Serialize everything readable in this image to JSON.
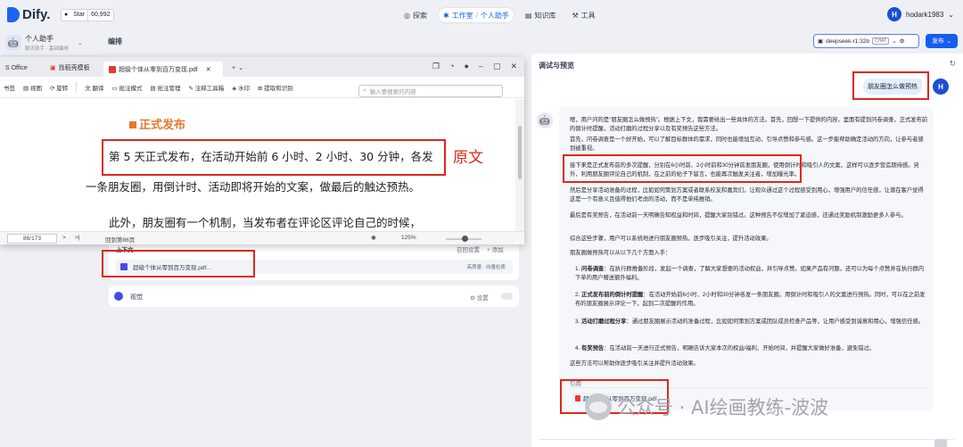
{
  "brand": {
    "name": "Dify.",
    "github_label": "Star",
    "github_count": "60,992"
  },
  "nav": {
    "explore": "探索",
    "studio": "工作室",
    "separator": "/",
    "app": "个人助手",
    "knowledge": "知识库",
    "tools": "工具"
  },
  "user": {
    "initial": "H",
    "name": "hodark1983"
  },
  "app": {
    "name": "个人助手",
    "type": "聊天助手 · 基础编排"
  },
  "editor": {
    "title": "编排"
  },
  "model": {
    "name": "deepseek-r1:32b",
    "mode": "CHAT",
    "publish": "发布"
  },
  "pdf": {
    "tabs": [
      "S Office",
      "找稻壳模板",
      "超级个体从零到百万变现.pdf"
    ],
    "new_tab": "+",
    "toolbar": [
      "书签",
      "视图",
      "旋转",
      "翻译",
      "批注模式",
      "批注管理",
      "注释工具箱",
      "水印",
      "提取和识别"
    ],
    "search_placeholder": "输入要搜索的内容",
    "section_heading": "正式发布",
    "lines": [
      "第 5 天正式发布，在活动开始前 6 小时、2 小时、30 分钟，各发",
      "一条朋友圈，用倒计时、活动即将开始的文案，做最后的触达预热。",
      "此外，朋友圈有一个机制，当发布者在评论区评论自己的时候，"
    ],
    "page_indicator": "86/173",
    "status_back": "回到第86页",
    "zoom": "125%",
    "annotation": "原文"
  },
  "context": {
    "header": "上下文",
    "recall_settings": "召回设置",
    "add": "+ 添加",
    "file_name": "超级个体从零到百万变现.pdf...",
    "file_tags": "高质量 · 向量检索"
  },
  "vision": {
    "label": "视觉",
    "settings": "设置"
  },
  "debug": {
    "title": "调试与预览",
    "question": "朋友圈怎么做预热",
    "answer": {
      "p1": "嗯，用户问的是\"朋友圈怎么做预热\"。根据上下文，我需要给出一些具体的方法。首先，回想一下提供的内容，里面有提到问卷调查，正式发布前的倒计时提醒，活动打磨的过程分享以及有奖预告这些方法。",
      "p2": "首先，问卷调查是一个好开始，可以了解目标群体的需求，同时也能增加互动，引导点赞和参与感。这一步能帮助确定活动的方向，让参与者感到被重视。",
      "p3": "接下来是正式发布前的多次提醒，分别在6小时前、2小时前和30分钟前发朋友圈，使用倒计时和吸引人的文案，这样可以逐步营造期待感。另外，利用朋友圈评论自己的机制，在之前的帖子下留言，也能再次触发关注者，增加曝光率。",
      "p4": "然后是分享活动准备的过程，比如如何策划方案或者联系校友和嘉宾们。让观众通过这个过程感受到用心，增强用户的信任感，让潜在客户觉得这是一个有意义且值得他们考虑的活动，而不是单纯推销。",
      "p5": "最后是有奖预告，在活动前一天明确告知权益和时间，提醒大家别错过。这种预告不仅增加了紧迫感，还通过奖励机制激励更多人参与。",
      "p6": "综合这些步骤，用户可以系统地进行朋友圈预热，逐步吸引关注，提升活动效果。",
      "p7": "朋友圈做预热可以从以下几个方面入手：",
      "items": [
        {
          "num": "1.",
          "title": "问卷调查",
          "text": "：在执行群推备阶段，发起一个调查，了解大家想要的活动权益，并引导点赞。如果产品有问题，还可以为每个点赞并在执行群内下单的用户赠送额外福利。"
        },
        {
          "num": "2.",
          "title": "正式发布前的倒计时提醒",
          "text": "：在活动开始前6小时、2小时和30分钟各发一条朋友圈，用倒计时和吸引人的文案进行预热。同时，可以在之前发布的朋友圈展示评论一下，起到二次提醒的作用。"
        },
        {
          "num": "3.",
          "title": "活动打磨过程分享",
          "text": "：通过朋友圈展示活动的准备过程，比如如何策划方案或团队成员检查产品等，让用户感受到诚意和用心，增强信任感。"
        },
        {
          "num": "4.",
          "title": "有奖预告",
          "text": "：在活动前一天进行正式预告，明确告诉大家本次的权益/福利、开始时间，并提醒大家做好准备，避免错过。"
        }
      ],
      "closing": "这些方法可以帮助你逐步吸引关注并提升活动效果。"
    },
    "citation_label": "引用",
    "citation_file": "超级个体从零到百万变现.pdf"
  },
  "watermark": "公众号 · AI绘画教练-波波"
}
